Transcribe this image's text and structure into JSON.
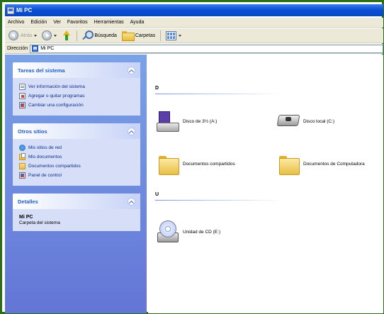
{
  "window": {
    "title": "Mi PC",
    "icon": "my-computer-icon"
  },
  "menu": [
    "Archivo",
    "Edición",
    "Ver",
    "Favoritos",
    "Herramientas",
    "Ayuda"
  ],
  "toolbar": {
    "back_label": "Atrás",
    "search_label": "Búsqueda",
    "folders_label": "Carpetas"
  },
  "address": {
    "label": "Dirección",
    "value": "Mi PC"
  },
  "sidebar": {
    "system_tasks": {
      "title": "Tareas del sistema",
      "items": [
        {
          "label": "Ver información del sistema",
          "icon": "system-info-icon"
        },
        {
          "label": "Agregar o quitar programas",
          "icon": "add-remove-programs-icon"
        },
        {
          "label": "Cambiar una configuración",
          "icon": "control-panel-icon"
        }
      ]
    },
    "other_places": {
      "title": "Otros sitios",
      "items": [
        {
          "label": "Mis sitios de red",
          "icon": "network-places-icon"
        },
        {
          "label": "Mis documentos",
          "icon": "my-documents-icon"
        },
        {
          "label": "Documentos compartidos",
          "icon": "shared-folder-icon"
        },
        {
          "label": "Panel de control",
          "icon": "control-panel-icon"
        }
      ]
    },
    "details": {
      "title": "Detalles",
      "name": "Mi PC",
      "description": "Carpeta del sistema"
    }
  },
  "content": {
    "group1_header": "D",
    "group2_header": "U",
    "items": {
      "floppy": {
        "label": "Disco de 3½ (A:)",
        "icon": "floppy-drive-icon"
      },
      "local_disk": {
        "label": "Disco local (C:)",
        "icon": "hard-disk-icon"
      },
      "shared_docs": {
        "label": "Documentos compartidos",
        "icon": "folder-icon"
      },
      "computer_docs": {
        "label": "Documentos de Computadora",
        "icon": "folder-icon"
      },
      "cd_drive": {
        "label": "Unidad de CD (E:)",
        "icon": "cd-drive-icon"
      }
    }
  },
  "colors": {
    "titlebar": "#0a4fd6",
    "taskpane": "#6f8ce0",
    "panel_title": "#215dc6",
    "link": "#0c2c8c"
  }
}
